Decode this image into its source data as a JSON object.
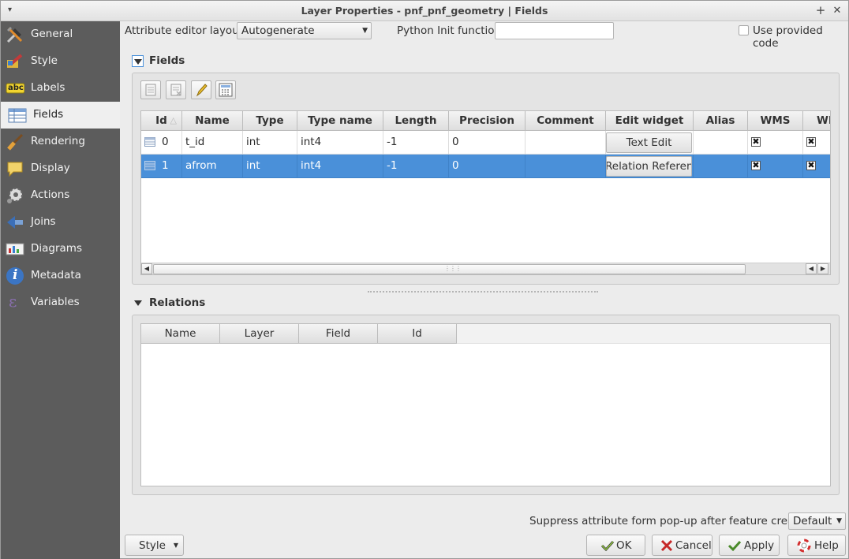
{
  "window": {
    "title": "Layer Properties - pnf_pnf_geometry | Fields",
    "pin_symbol": "+",
    "close_symbol": "✕",
    "menu_symbol": "▾"
  },
  "sidebar": {
    "items": [
      {
        "label": "General",
        "icon": "tools-icon"
      },
      {
        "label": "Style",
        "icon": "paintbrush-icon"
      },
      {
        "label": "Labels",
        "icon": "abc-label-icon",
        "badge": "abc"
      },
      {
        "label": "Fields",
        "icon": "table-icon",
        "active": true
      },
      {
        "label": "Rendering",
        "icon": "brush-icon"
      },
      {
        "label": "Display",
        "icon": "speech-bubble-icon"
      },
      {
        "label": "Actions",
        "icon": "gear-icon"
      },
      {
        "label": "Joins",
        "icon": "join-arrow-icon"
      },
      {
        "label": "Diagrams",
        "icon": "diagram-icon"
      },
      {
        "label": "Metadata",
        "icon": "info-icon",
        "badge": "i"
      },
      {
        "label": "Variables",
        "icon": "epsilon-icon",
        "badge": "ε"
      }
    ]
  },
  "top": {
    "layout_label": "Attribute editor layout:",
    "layout_value": "Autogenerate",
    "python_label": "Python Init function",
    "python_value": "",
    "use_code_label": "Use provided code"
  },
  "fields_section": {
    "title": "Fields",
    "columns": [
      "Id",
      "Name",
      "Type",
      "Type name",
      "Length",
      "Precision",
      "Comment",
      "Edit widget",
      "Alias",
      "WMS",
      "WFS"
    ],
    "rows": [
      {
        "id": "0",
        "name": "t_id",
        "type": "int",
        "type_name": "int4",
        "length": "-1",
        "precision": "0",
        "comment": "",
        "edit_widget": "Text Edit",
        "alias": "",
        "wms": "✖",
        "wfs": "✖"
      },
      {
        "id": "1",
        "name": "afrom",
        "type": "int",
        "type_name": "int4",
        "length": "-1",
        "precision": "0",
        "comment": "",
        "edit_widget": "Relation Reference",
        "alias": "",
        "wms": "✖",
        "wfs": "✖",
        "selected": true
      }
    ],
    "wfs_visible": "WI"
  },
  "relations_section": {
    "title": "Relations",
    "columns": [
      "Name",
      "Layer",
      "Field",
      "Id"
    ]
  },
  "bottom": {
    "suppress_label": "Suppress attribute form pop-up after feature creation",
    "suppress_value": "Default",
    "style_label": "Style",
    "ok_label": "OK",
    "cancel_label": "Cancel",
    "apply_label": "Apply",
    "help_label": "Help"
  },
  "colors": {
    "accent": "#4a90d9",
    "sidebar": "#5c5c5c"
  }
}
